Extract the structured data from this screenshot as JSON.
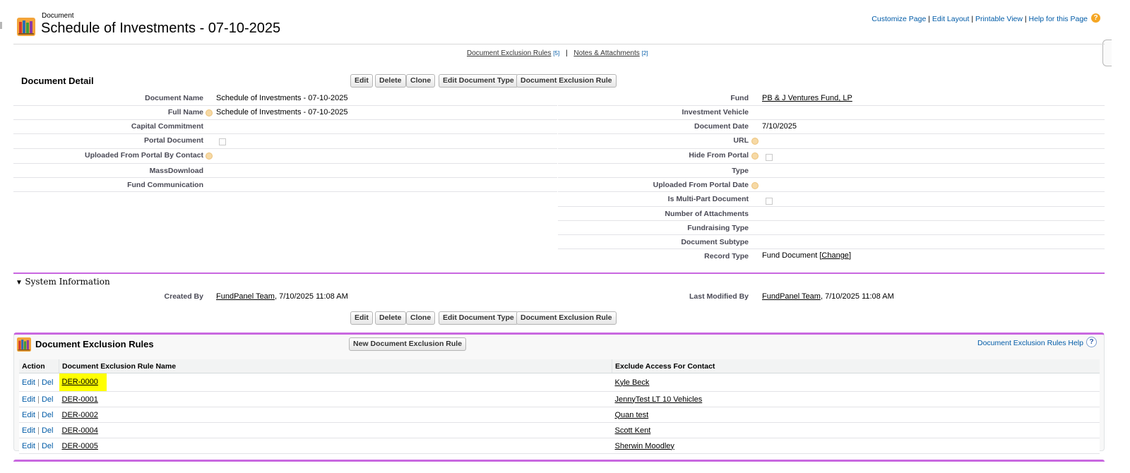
{
  "header": {
    "object_label": "Document",
    "title": "Schedule of Investments - 07-10-2025",
    "links": [
      "Customize Page",
      "Edit Layout",
      "Printable View",
      "Help for this Page"
    ],
    "sep": "|"
  },
  "related_links": {
    "exclusion": {
      "label": "Document Exclusion Rules",
      "count": "[5]"
    },
    "notes": {
      "label": "Notes & Attachments",
      "count": "[2]"
    },
    "sep": "|"
  },
  "detail": {
    "title": "Document Detail",
    "buttons": [
      "Edit",
      "Delete",
      "Clone",
      "Edit Document Type",
      "Document Exclusion Rule"
    ],
    "left": [
      {
        "label": "Document Name",
        "value": "Schedule of Investments - 07-10-2025"
      },
      {
        "label": "Full Name",
        "value": "Schedule of Investments - 07-10-2025"
      },
      {
        "label": "Capital Commitment",
        "value": ""
      },
      {
        "label": "Portal Document",
        "value": ""
      },
      {
        "label": "Uploaded From Portal By Contact",
        "value": ""
      },
      {
        "label": "MassDownload",
        "value": ""
      },
      {
        "label": "Fund Communication",
        "value": ""
      }
    ],
    "right": [
      {
        "label": "Fund",
        "value": "PB & J Ventures Fund, LP"
      },
      {
        "label": "Investment Vehicle",
        "value": ""
      },
      {
        "label": "Document Date",
        "value": "7/10/2025"
      },
      {
        "label": "URL",
        "value": ""
      },
      {
        "label": "Hide From Portal",
        "value": ""
      },
      {
        "label": "Type",
        "value": ""
      },
      {
        "label": "Uploaded From Portal Date",
        "value": ""
      },
      {
        "label": "Is Multi-Part Document",
        "value": ""
      },
      {
        "label": "Number of Attachments",
        "value": ""
      },
      {
        "label": "Fundraising Type",
        "value": ""
      },
      {
        "label": "Document Subtype",
        "value": ""
      },
      {
        "label": "Record Type",
        "value": "Fund Document",
        "change": "Change"
      }
    ]
  },
  "system_info": {
    "title": "System Information",
    "created_label": "Created By",
    "created_user": "FundPanel Team",
    "created_date": ", 7/10/2025 11:08 AM",
    "modified_label": "Last Modified By",
    "modified_user": "FundPanel Team",
    "modified_date": ", 7/10/2025 11:08 AM"
  },
  "related_list": {
    "title": "Document Exclusion Rules",
    "new_button": "New Document Exclusion Rule",
    "help": "Document Exclusion Rules Help",
    "columns": [
      "Action",
      "Document Exclusion Rule Name",
      "Exclude Access For Contact"
    ],
    "action_edit": "Edit",
    "action_del": "Del",
    "action_sep": "|",
    "rows": [
      {
        "name": "DER-0000",
        "contact": "Kyle Beck"
      },
      {
        "name": "DER-0001",
        "contact": "JennyTest LT 10 Vehicles"
      },
      {
        "name": "DER-0002",
        "contact": "Quan test"
      },
      {
        "name": "DER-0004",
        "contact": "Scott Kent"
      },
      {
        "name": "DER-0005",
        "contact": "Sherwin Moodley"
      }
    ]
  },
  "colors": {
    "accent": "#c968e0",
    "link": "#015ba7",
    "highlight": "#ffff00"
  }
}
